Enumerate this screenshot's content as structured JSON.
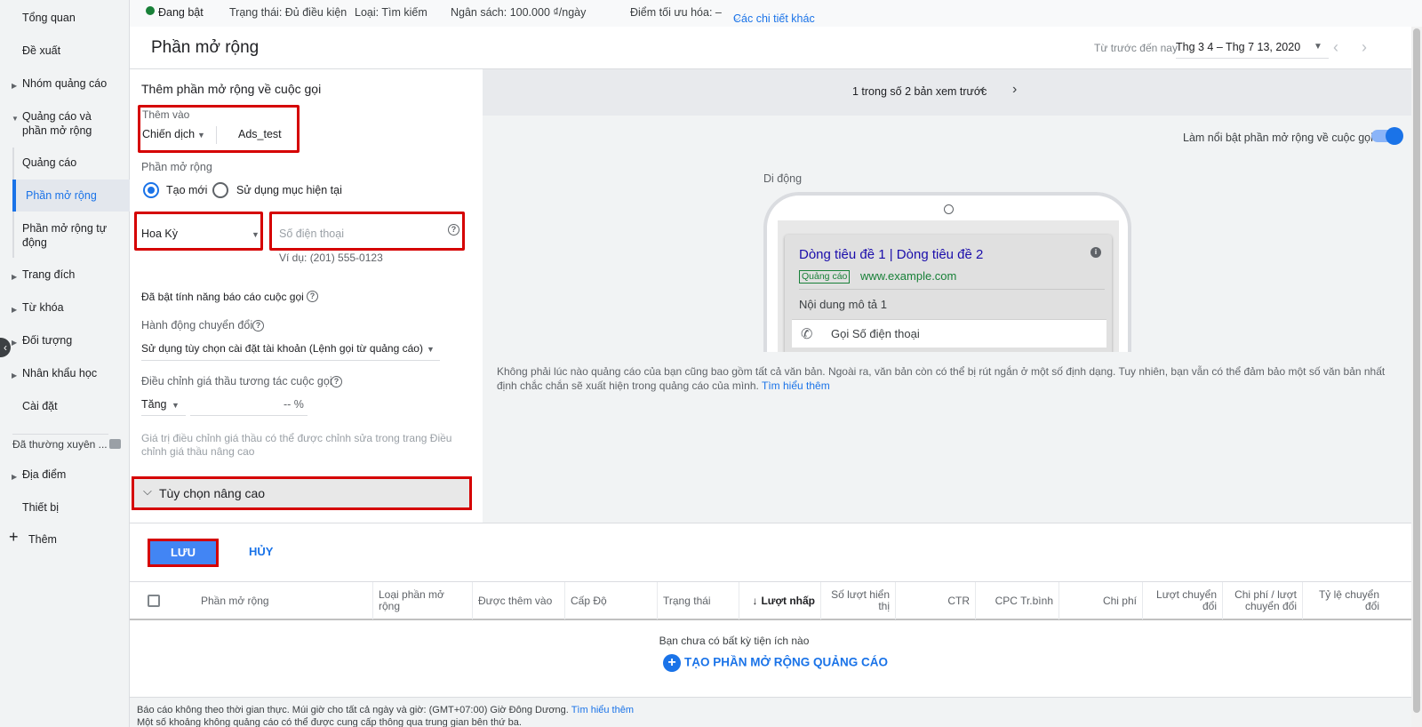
{
  "sidebar": {
    "items": [
      {
        "label": "Tổng quan"
      },
      {
        "label": "Đề xuất"
      },
      {
        "label": "Nhóm quảng cáo"
      },
      {
        "label": "Quảng cáo và phần mở rộng"
      },
      {
        "label": "Quảng cáo"
      },
      {
        "label": "Phần mở rộng"
      },
      {
        "label": "Phần mở rộng tự động"
      },
      {
        "label": "Trang đích"
      },
      {
        "label": "Từ khóa"
      },
      {
        "label": "Đối tượng"
      },
      {
        "label": "Nhân khẩu học"
      },
      {
        "label": "Cài đặt"
      },
      {
        "label": "Đã thường xuyên ..."
      },
      {
        "label": "Địa điểm"
      },
      {
        "label": "Thiết bị"
      },
      {
        "label": "Thêm"
      }
    ]
  },
  "status_bar": {
    "state": "Đang bật",
    "status": "Trạng thái: Đủ điều kiện",
    "type": "Loại: Tìm kiếm",
    "budget": "Ngân sách: 100.000 ₫/ngày",
    "optimization": "Điểm tối ưu hóa: –",
    "details_link": "Các chi tiết khác",
    "status_color": "#188038"
  },
  "header": {
    "title": "Phần mở rộng",
    "date_label": "Từ trước đến nay",
    "date_range": "Thg 3 4 – Thg 7 13, 2020"
  },
  "form": {
    "heading": "Thêm phần mở rộng về cuộc gọi",
    "add_to_label": "Thêm vào",
    "add_to_value": "Chiến dịch",
    "campaign_name": "Ads_test",
    "extension_label": "Phần mở rộng",
    "radio_new": "Tạo mới",
    "radio_existing": "Sử dụng mục hiện tại",
    "country": "Hoa Kỳ",
    "phone_placeholder": "Số điện thoại",
    "phone_example": "Ví dụ: (201) 555-0123",
    "call_reporting": "Đã bật tính năng báo cáo cuộc gọi",
    "conversion_action_label": "Hành động chuyển đổi",
    "conversion_action_value": "Sử dụng tùy chọn cài đặt tài khoản (Lệnh gọi từ quảng cáo)",
    "bid_adjust_label": "Điều chỉnh giá thầu tương tác cuộc gọi",
    "bid_direction": "Tăng",
    "bid_value": "-- %",
    "bid_note": "Giá trị điều chỉnh giá thầu có thể được chỉnh sửa trong trang Điều chỉnh giá thầu nâng cao",
    "advanced_options": "Tùy chọn nâng cao"
  },
  "preview": {
    "counter": "1 trong số 2 bản xem trước",
    "highlight_label": "Làm nổi bật phần mở rộng về cuộc gọi",
    "highlight_on": true,
    "device_label": "Di động",
    "ad_headline": "Dòng tiêu đề 1 | Dòng tiêu đề 2",
    "ad_badge": "Quảng cáo",
    "ad_url": "www.example.com",
    "ad_description": "Nội dung mô tả 1",
    "call_text": "Gọi Số điện thoại",
    "note": "Không phải lúc nào quảng cáo của bạn cũng bao gồm tất cả văn bản. Ngoài ra, văn bản còn có thể bị rút ngắn ở một số định dạng. Tuy nhiên, bạn vẫn có thể đảm bảo một số văn bản nhất định chắc chắn sẽ xuất hiện trong quảng cáo của mình.",
    "learn_more": "Tìm hiểu thêm"
  },
  "actions": {
    "save": "LƯU",
    "cancel": "HỦY"
  },
  "table": {
    "columns": [
      "Phần mở rộng",
      "Loại phần mở rộng",
      "Được thêm vào",
      "Cấp Độ",
      "Trạng thái",
      "Lượt nhấp",
      "Số lượt hiển thị",
      "CTR",
      "CPC Tr.bình",
      "Chi phí",
      "Lượt chuyển đổi",
      "Chi phí / lượt chuyển đổi",
      "Tỷ lệ chuyển đổi"
    ],
    "empty_message": "Bạn chưa có bất kỳ tiện ích nào",
    "create_link": "TẠO PHẦN MỞ RỘNG QUẢNG CÁO"
  },
  "footer": {
    "line1": "Báo cáo không theo thời gian thực. Múi giờ cho tất cả ngày và giờ: (GMT+07:00) Giờ Đông Dương.",
    "line1_link": "Tìm hiểu thêm",
    "line2": "Một số khoảng không quảng cáo có thể được cung cấp thông qua trung gian bên thứ ba."
  },
  "colors": {
    "accent": "#1a73e8",
    "highlight_box": "#d50000",
    "save_button": "#4285f4"
  }
}
